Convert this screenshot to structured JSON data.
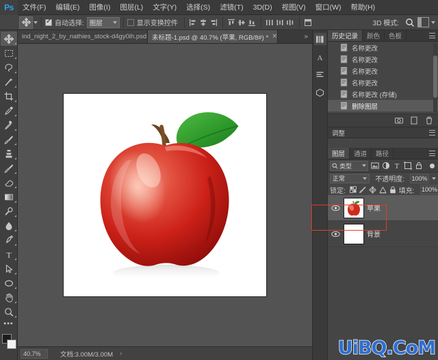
{
  "app": {
    "logo": "Ps",
    "accent": "#2ba3e8"
  },
  "menubar": {
    "items": [
      {
        "label": "文件(F)"
      },
      {
        "label": "编辑(E)"
      },
      {
        "label": "图像(I)"
      },
      {
        "label": "图层(L)"
      },
      {
        "label": "文字(Y)"
      },
      {
        "label": "选择(S)"
      },
      {
        "label": "滤镜(T)"
      },
      {
        "label": "3D(D)"
      },
      {
        "label": "视图(V)"
      },
      {
        "label": "窗口(W)"
      },
      {
        "label": "帮助(H)"
      }
    ]
  },
  "options_bar": {
    "tool_icon": "move-tool-icon",
    "auto_select_label": "自动选择:",
    "auto_select_checked": true,
    "auto_select_scope": "图层",
    "show_transform_label": "显示变换控件",
    "show_transform_checked": false,
    "mode_3d_label": "3D 模式:",
    "search_icon": "search-icon",
    "workspace_icon": "workspace-icon"
  },
  "toolbar": {
    "tools": [
      {
        "name": "move-tool",
        "selected": true
      },
      {
        "name": "marquee-tool",
        "selected": false
      },
      {
        "name": "lasso-tool",
        "selected": false
      },
      {
        "name": "magic-wand-tool",
        "selected": false
      },
      {
        "name": "crop-tool",
        "selected": false
      },
      {
        "name": "eyedropper-tool",
        "selected": false
      },
      {
        "name": "healing-brush-tool",
        "selected": false
      },
      {
        "name": "brush-tool",
        "selected": false
      },
      {
        "name": "clone-stamp-tool",
        "selected": false
      },
      {
        "name": "history-brush-tool",
        "selected": false
      },
      {
        "name": "eraser-tool",
        "selected": false
      },
      {
        "name": "gradient-tool",
        "selected": false
      },
      {
        "name": "dodge-tool",
        "selected": false
      },
      {
        "name": "blur-tool",
        "selected": false
      },
      {
        "name": "pen-tool",
        "selected": false
      },
      {
        "name": "type-tool",
        "selected": false
      },
      {
        "name": "path-selection-tool",
        "selected": false
      },
      {
        "name": "shape-tool",
        "selected": false
      },
      {
        "name": "hand-tool",
        "selected": false
      },
      {
        "name": "zoom-tool",
        "selected": false
      }
    ],
    "more_tools": "•••",
    "foreground_color": "#1c1c1c",
    "background_color": "#f2f2f2"
  },
  "document_tabs": [
    {
      "label": "ind_night_2_by_nathies_stock-d4gy0ih.psd",
      "close": "✕",
      "active": false
    },
    {
      "label": "未标题-1.psd @ 40.7% (苹果, RGB/8#) *",
      "close": "✕",
      "active": true
    }
  ],
  "tabstrip": {
    "overflow": "»"
  },
  "canvas": {
    "artboard_background": "#ffffff",
    "frame_color": "#2a2a2a"
  },
  "statusbar": {
    "zoom": "40.7%",
    "doc_info": "文档:3.00M/3.00M",
    "arrow": "›"
  },
  "rail": {
    "icons": [
      {
        "name": "libraries-icon"
      },
      {
        "name": "character-icon"
      },
      {
        "name": "paragraph-icon"
      },
      {
        "name": "3d-icon"
      }
    ]
  },
  "history_panel": {
    "tabs": [
      {
        "label": "历史记录",
        "active": true
      },
      {
        "label": "颜色",
        "active": false
      },
      {
        "label": "色板",
        "active": false
      }
    ],
    "items": [
      {
        "label": "名称更改",
        "selected": false
      },
      {
        "label": "名称更改",
        "selected": false
      },
      {
        "label": "名称更改",
        "selected": false
      },
      {
        "label": "名称更改",
        "selected": false
      },
      {
        "label": "名称更改 (存储)",
        "selected": false
      },
      {
        "label": "删除图层",
        "selected": true
      }
    ],
    "footer_icons": [
      {
        "name": "snapshot-icon"
      },
      {
        "name": "new-document-icon"
      },
      {
        "name": "delete-icon"
      }
    ]
  },
  "adjustments_panel": {
    "title": "调整"
  },
  "layers_panel": {
    "tabs": [
      {
        "label": "图层",
        "active": true
      },
      {
        "label": "通道",
        "active": false
      },
      {
        "label": "路径",
        "active": false
      }
    ],
    "filter": {
      "search_icon": "search-icon",
      "type_label": "类型",
      "icons": [
        {
          "name": "filter-pixel-icon"
        },
        {
          "name": "filter-adjustment-icon"
        },
        {
          "name": "filter-type-icon"
        },
        {
          "name": "filter-shape-icon"
        },
        {
          "name": "filter-smart-object-icon"
        }
      ],
      "toggle": "filter-toggle-icon"
    },
    "blend_mode": "正常",
    "opacity_label": "不透明度:",
    "opacity_value": "100%",
    "lock_label": "锁定:",
    "lock_icons": [
      {
        "name": "lock-transparent-pixels-icon"
      },
      {
        "name": "lock-image-pixels-icon"
      },
      {
        "name": "lock-position-icon"
      },
      {
        "name": "lock-artboard-icon"
      },
      {
        "name": "lock-all-icon"
      }
    ],
    "fill_label": "填充:",
    "fill_value": "100%",
    "layers": [
      {
        "name": "苹果",
        "visible": true,
        "selected": true,
        "thumb": "apple"
      },
      {
        "name": "背景",
        "visible": true,
        "selected": false,
        "thumb": "white"
      }
    ]
  },
  "annotation": {
    "color": "#e23b2e",
    "target": "apple-layer-row"
  },
  "watermark": {
    "text": "UiBQ.CoM",
    "color": "#2f6fd0"
  }
}
